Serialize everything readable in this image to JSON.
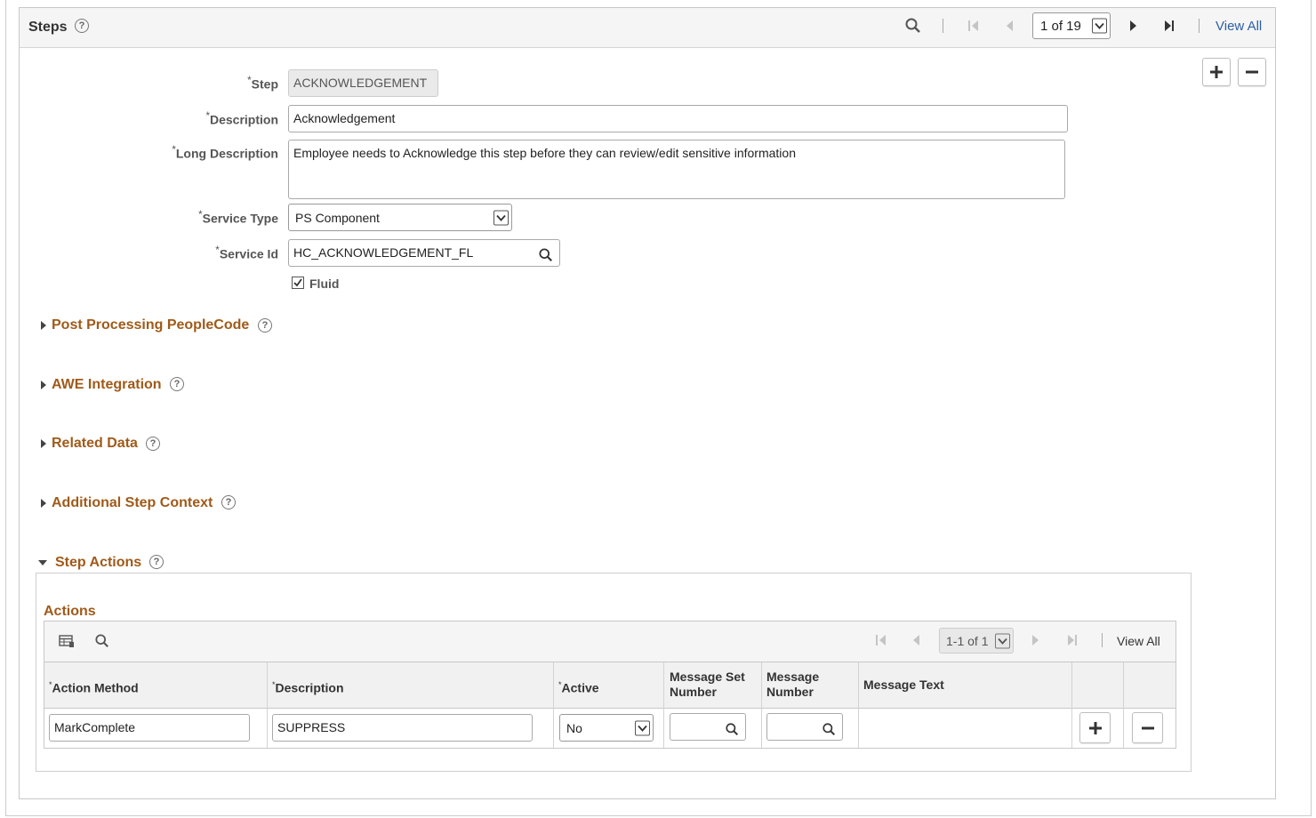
{
  "steps": {
    "title": "Steps",
    "pager": "1 of 19",
    "view_all": "View All"
  },
  "form": {
    "step_label": "Step",
    "step_value": "ACKNOWLEDGEMENT",
    "description_label": "Description",
    "description_value": "Acknowledgement",
    "long_description_label": "Long Description",
    "long_description_value": "Employee needs to Acknowledge this step before they can review/edit sensitive information",
    "service_type_label": "Service Type",
    "service_type_value": "PS Component",
    "service_id_label": "Service Id",
    "service_id_value": "HC_ACKNOWLEDGEMENT_FL",
    "fluid_label": "Fluid",
    "required_marker": "*"
  },
  "sections": {
    "post_processing": "Post Processing PeopleCode",
    "awe_integration": "AWE Integration",
    "related_data": "Related Data",
    "additional_step_context": "Additional Step Context",
    "step_actions": "Step Actions"
  },
  "actions": {
    "title": "Actions",
    "pager": "1-1 of 1",
    "view_all": "View All",
    "columns": {
      "action_method": "Action Method",
      "description": "Description",
      "active": "Active",
      "message_set_line1": "Message Set",
      "message_set_line2": "Number",
      "message_number_line1": "Message",
      "message_number_line2": "Number",
      "message_text": "Message Text"
    },
    "rows": [
      {
        "action_method": "MarkComplete",
        "description": "SUPPRESS",
        "active": "No",
        "message_set": "",
        "message_number": "",
        "message_text": ""
      }
    ]
  },
  "icons": [
    "search-icon",
    "help-icon",
    "first-page-icon",
    "prev-page-icon",
    "next-page-icon",
    "last-page-icon",
    "plus-icon",
    "minus-icon",
    "checkbox-checked-icon",
    "chevron-down-icon",
    "grid-personalize-icon",
    "caret-right-icon",
    "caret-down-icon"
  ],
  "colors": {
    "section_heading": "#a05a19",
    "link": "#2c5fa6"
  }
}
